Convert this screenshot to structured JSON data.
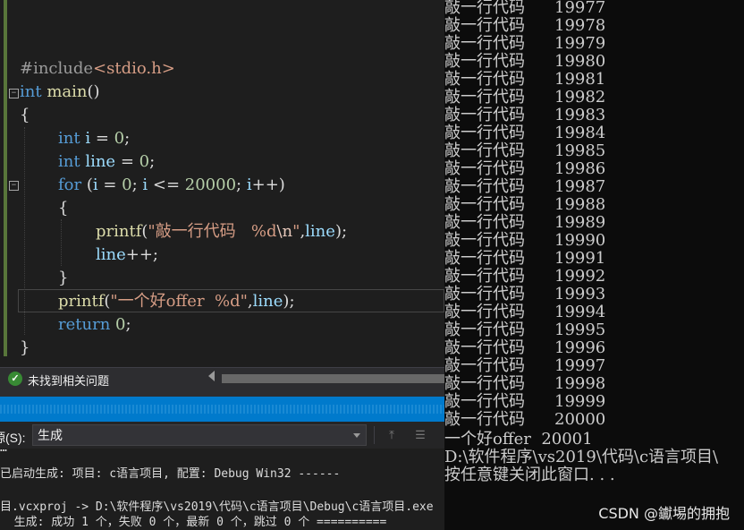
{
  "editor": {
    "include_directive": "#include",
    "include_header": "<stdio.h>",
    "kw_int": "int",
    "main_name": "main",
    "main_parens": "()",
    "open_brace": "{",
    "close_brace": "}",
    "var_i": "i",
    "var_line": "line",
    "assign_zero": " = ",
    "zero": "0",
    "semicolon": ";",
    "kw_for": "for",
    "for_open": " (",
    "for_cond1": " = ",
    "for_sep": "; ",
    "for_le": " <= ",
    "limit": "20000",
    "for_inc": "++)",
    "printf_name": "printf",
    "printf1_str": "\"敲一行代码   %d",
    "printf1_esc": "\\n",
    "printf1_str_end": "\"",
    "printf1_args": ",",
    "printf1_tail": ");",
    "line_inc": "++;",
    "printf2_str": "\"一个好offer  %d\"",
    "printf2_tail": ");",
    "kw_return": "return",
    "return_value": "0"
  },
  "status": {
    "icon": "check-circle-icon",
    "text": "未找到相关问题"
  },
  "output": {
    "source_label": "源(S):",
    "source_value": "生成",
    "lines": [
      "已启动生成: 项目: c语言项目, 配置: Debug Win32 ------",
      "",
      "目.vcxproj -> D:\\软件程序\\vs2019\\代码\\c语言项目\\Debug\\c语言项目.exe",
      "  生成: 成功 1 个，失败 0 个，最新 0 个，跳过 0 个 =========="
    ],
    "partial_top": "…"
  },
  "console": {
    "prefix": "敲一行代码",
    "rows": [
      "19977",
      "19978",
      "19979",
      "19980",
      "19981",
      "19982",
      "19983",
      "19984",
      "19985",
      "19986",
      "19987",
      "19988",
      "19989",
      "19990",
      "19991",
      "19992",
      "19993",
      "19994",
      "19995",
      "19996",
      "19997",
      "19998",
      "19999",
      "20000"
    ],
    "final_line": "一个好offer  20001",
    "path_line": "D:\\软件程序\\vs2019\\代码\\c语言项目\\",
    "close_prompt": "按任意键关闭此窗口. . ."
  },
  "watermark": "CSDN @钀埸的拥抱",
  "colors": {
    "editor_bg": "#1e1e1e",
    "keyword": "#569cd6",
    "function": "#dcdcaa",
    "string": "#d69d85",
    "number": "#b5cea8",
    "identifier": "#9cdcfe",
    "change_bar": "#58763a",
    "accent_blue": "#007acc",
    "console_bg": "#0c0c0c"
  }
}
